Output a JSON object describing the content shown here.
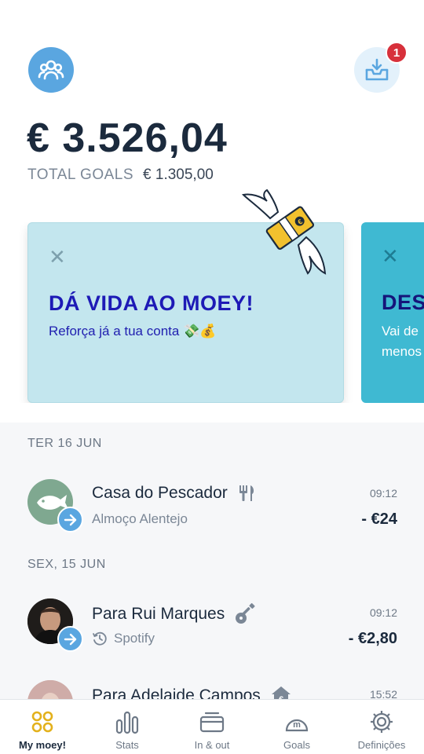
{
  "header": {
    "group_icon": "group-icon",
    "inbox_icon": "inbox-download-icon",
    "notification_count": "1"
  },
  "balance": {
    "amount": "€ 3.526,04",
    "goals_label": "TOTAL GOALS",
    "goals_value": "€ 1.305,00"
  },
  "cards": [
    {
      "close": "✕",
      "title": "DÁ VIDA AO MOEY!",
      "subtitle": "Reforça já a tua conta 💸💰"
    },
    {
      "close": "✕",
      "title": "DES",
      "subtitle_line1": "Vai de",
      "subtitle_line2": "menos"
    }
  ],
  "feed": {
    "days": [
      {
        "label": "TER 16 JUN",
        "transactions": [
          {
            "name": "Casa do Pescador",
            "category_icon": "fork-knife-icon",
            "description": "Almoço Alentejo",
            "time": "09:12",
            "amount": "- €24"
          }
        ]
      },
      {
        "label": "SEX, 15 JUN",
        "transactions": [
          {
            "name": "Para Rui Marques",
            "category_icon": "guitar-icon",
            "description": "Spotify",
            "time": "09:12",
            "amount": "- €2,80"
          },
          {
            "name": "Para Adelaide Campos",
            "category_icon": "house-euro-icon",
            "description": "",
            "time": "15:52",
            "amount": ""
          }
        ]
      }
    ]
  },
  "nav": {
    "items": [
      {
        "label": "My moey!",
        "icon": "dots-grid-icon",
        "active": true
      },
      {
        "label": "Stats",
        "icon": "bar-chart-icon",
        "active": false
      },
      {
        "label": "In & out",
        "icon": "card-icon",
        "active": false
      },
      {
        "label": "Goals",
        "icon": "piggy-icon",
        "active": false
      },
      {
        "label": "Definições",
        "icon": "gear-icon",
        "active": false
      }
    ]
  },
  "colors": {
    "primary_blue": "#5aa6e0",
    "card_light": "#c3e6ee",
    "card_dark": "#3fb9d2",
    "title_ink": "#1d1ab6",
    "badge_red": "#d7303b",
    "nav_active_gold": "#e3b11c"
  }
}
